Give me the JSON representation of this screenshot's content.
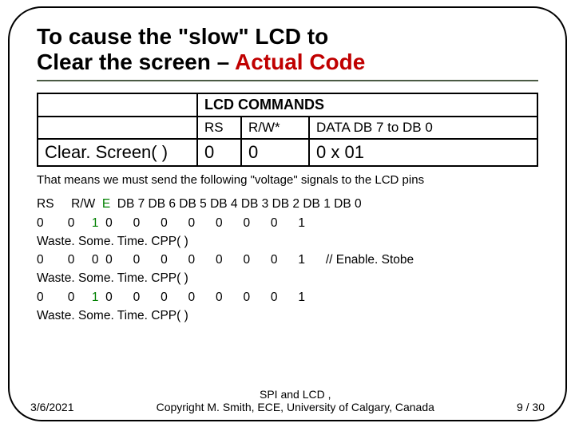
{
  "title": {
    "line1": "To cause the \"slow\" LCD to",
    "line2a": "Clear the screen – ",
    "line2b": "Actual Code"
  },
  "table": {
    "header": "LCD COMMANDS",
    "cols": {
      "c1": "RS",
      "c2": "R/W*",
      "c3": "DATA  DB 7 to DB 0"
    },
    "row": {
      "label": "Clear. Screen( )",
      "c1": "0",
      "c2": "0",
      "c3": "0 x 01"
    }
  },
  "explain": "That means we must send the following \"voltage\" signals to the LCD pins",
  "pins": {
    "hdr_a": "RS     R/W  ",
    "hdr_e": "E",
    "hdr_b": "  DB 7 DB 6 DB 5 DB 4 DB 3 DB 2 DB 1 DB 0",
    "r1_a": "0       0     ",
    "r1_e": "1",
    "r1_b": "  0      0      0      0      0      0      0      1",
    "w1": "Waste. Some. Time. CPP( )",
    "r2": "0       0     0  0      0      0      0      0      0      0      1      // Enable. Stobe",
    "w2": "Waste. Some. Time. CPP( )",
    "r3_a": "0       0     ",
    "r3_e": "1",
    "r3_b": "  0      0      0      0      0      0      0      1",
    "w3": "Waste. Some. Time. CPP( )"
  },
  "footer": {
    "date": "3/6/2021",
    "center1": "SPI and LCD                                   ,",
    "center2": "Copyright M. Smith, ECE, University of Calgary, Canada",
    "page": "9 / 30"
  }
}
